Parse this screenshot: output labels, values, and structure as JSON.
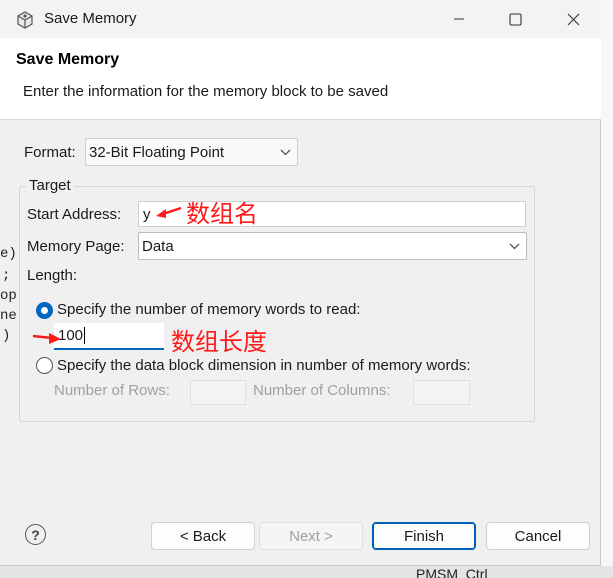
{
  "window": {
    "title": "Save Memory",
    "icon": "gear-cube-icon",
    "controls": [
      "minimize-icon",
      "maximize-icon",
      "close-icon"
    ]
  },
  "banner": {
    "title": "Save Memory",
    "message": "Enter the information for the memory block to be saved"
  },
  "format": {
    "label": "Format:",
    "selected": "32-Bit Floating Point"
  },
  "target": {
    "legend": "Target",
    "start_address_label": "Start Address:",
    "start_address_value": "y",
    "memory_page_label": "Memory Page:",
    "memory_page_selected": "Data",
    "length_label": "Length:",
    "option_words_label": "Specify the number of memory words to read:",
    "option_words_selected": true,
    "words_value": "100",
    "option_dimension_label": "Specify the data block dimension in number of memory words:",
    "option_dimension_selected": false,
    "rows_label": "Number of Rows:",
    "columns_label": "Number of Columns:"
  },
  "annotations": {
    "array_name": "数组名",
    "array_length": "数组长度",
    "color": "#ff1a1a"
  },
  "buttons": {
    "help": "?",
    "back": "< Back",
    "next": "Next >",
    "finish": "Finish",
    "cancel": "Cancel"
  },
  "background": {
    "fragments": [
      "e)",
      ";",
      "op",
      "ne",
      ")",
      "PMSM_Ctrl"
    ]
  },
  "colors": {
    "accent": "#0067c0",
    "dialog_bg": "#f0f0f0",
    "banner_bg": "#ffffff"
  }
}
